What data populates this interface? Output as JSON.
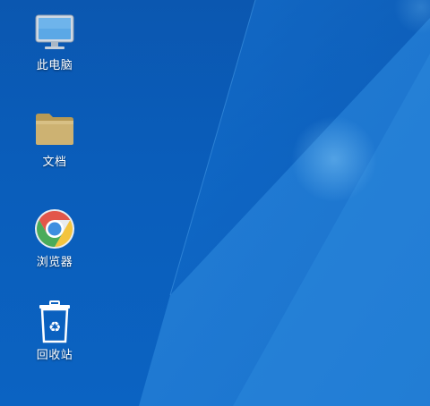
{
  "desktop": {
    "icons": [
      {
        "label": "此电脑",
        "icon": "computer-icon"
      },
      {
        "label": "文档",
        "icon": "folder-icon"
      },
      {
        "label": "浏览器",
        "icon": "browser-icon"
      },
      {
        "label": "回收站",
        "icon": "recycle-bin-icon"
      }
    ]
  },
  "colors": {
    "wallpaper_dark": "#0b57b0",
    "wallpaper_light": "#2f8fe0",
    "folder": "#cdb272",
    "label_text": "#ffffff"
  }
}
